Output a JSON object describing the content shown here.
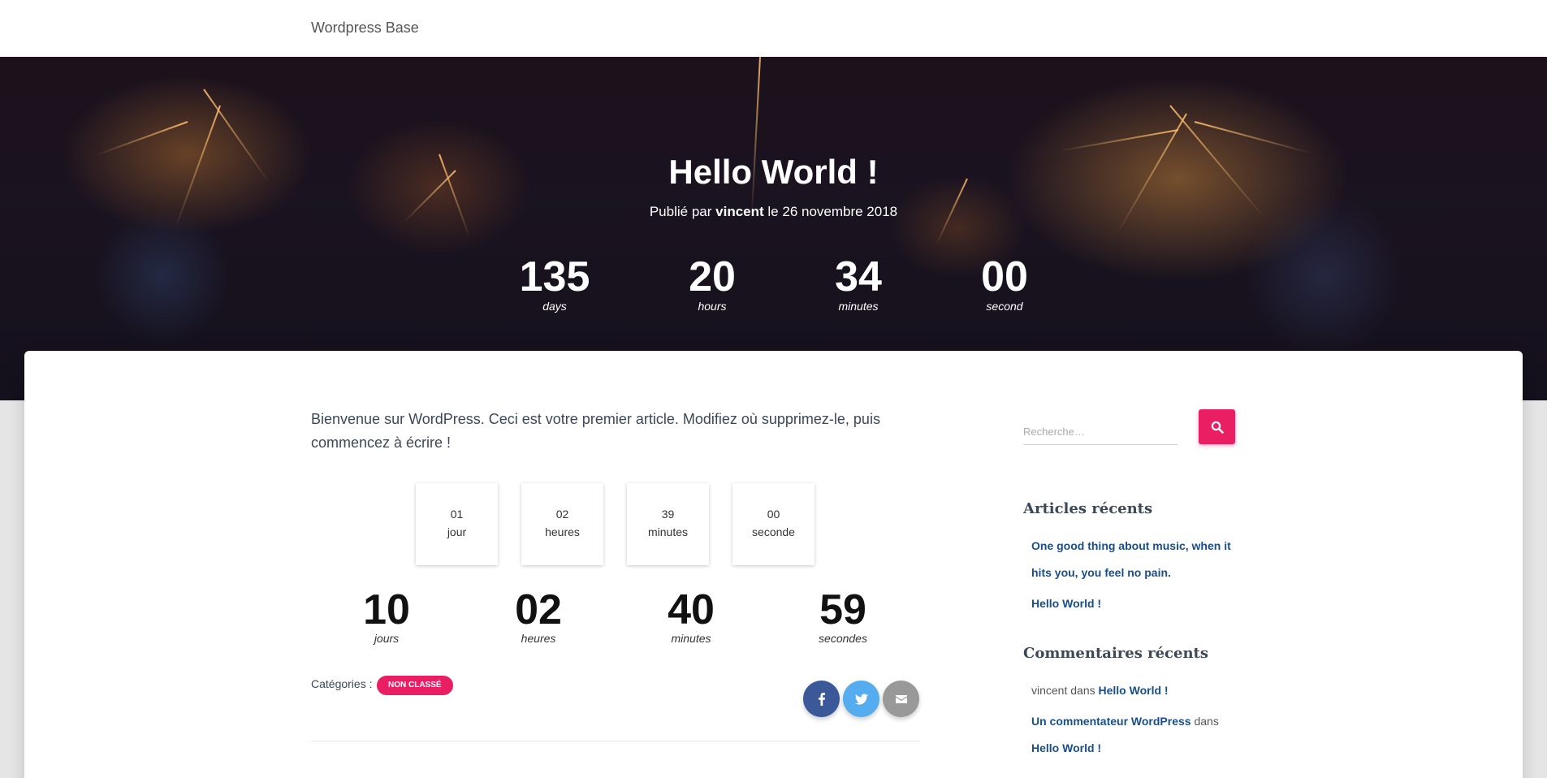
{
  "site": {
    "title": "Wordpress Base"
  },
  "hero": {
    "title": "Hello World !",
    "meta_prefix": "Publié par",
    "author": "vincent",
    "meta_suffix": "le 26 novembre 2018",
    "countdown": [
      {
        "value": "135",
        "label": "days"
      },
      {
        "value": "20",
        "label": "hours"
      },
      {
        "value": "34",
        "label": "minutes"
      },
      {
        "value": "00",
        "label": "second"
      }
    ]
  },
  "post": {
    "intro": "Bienvenue sur WordPress. Ceci est votre premier article. Modifiez où supprimez-le, puis commencez à écrire !",
    "boxes": [
      {
        "value": "01",
        "label": "jour"
      },
      {
        "value": "02",
        "label": "heures"
      },
      {
        "value": "39",
        "label": "minutes"
      },
      {
        "value": "00",
        "label": "seconde"
      }
    ],
    "countdown2": [
      {
        "value": "10",
        "label": "jours"
      },
      {
        "value": "02",
        "label": "heures"
      },
      {
        "value": "40",
        "label": "minutes"
      },
      {
        "value": "59",
        "label": "secondes"
      }
    ],
    "categories_label": "Catégories :",
    "category": "NON CLASSÉ",
    "share_icons": [
      "facebook-icon",
      "twitter-icon",
      "email-icon"
    ]
  },
  "sidebar": {
    "search_placeholder": "Recherche…",
    "recent_posts_title": "Articles récents",
    "recent_posts": [
      "One good thing about music, when it",
      "hits you, you feel no pain.",
      "Hello World !"
    ],
    "recent_comments_title": "Commentaires récents",
    "comments": [
      {
        "author": "vincent",
        "in": "dans",
        "post": "Hello World !"
      },
      {
        "author": "Un commentateur WordPress",
        "in": "dans",
        "post": "Hello World !"
      }
    ]
  },
  "colors": {
    "accent": "#e91e63",
    "link": "#1a4e8a",
    "facebook": "#3b5998",
    "twitter": "#55acee",
    "email": "#999999"
  }
}
